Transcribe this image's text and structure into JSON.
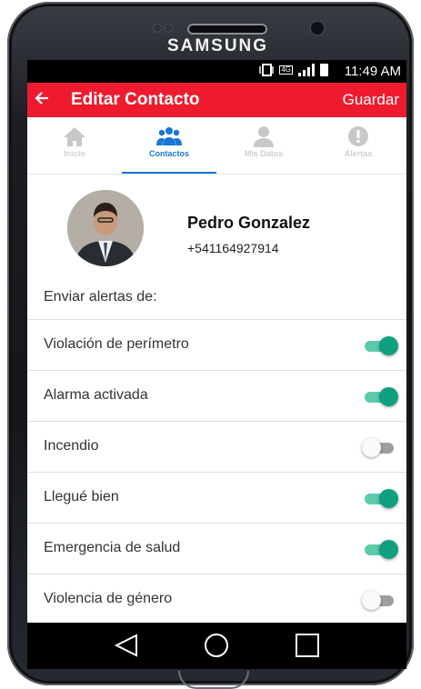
{
  "device": {
    "brand": "SAMSUNG"
  },
  "status_bar": {
    "time": "11:49 AM",
    "network": "4G"
  },
  "app_bar": {
    "title": "Editar Contacto",
    "back_icon": "arrow-left-icon",
    "save_label": "Guardar"
  },
  "tabs": [
    {
      "label": "Inicio",
      "icon": "home-icon",
      "active": false
    },
    {
      "label": "Contactos",
      "icon": "people-icon",
      "active": true
    },
    {
      "label": "Mis Datos",
      "icon": "person-icon",
      "active": false
    },
    {
      "label": "Alertas",
      "icon": "alert-icon",
      "active": false
    }
  ],
  "contact": {
    "name": "Pedro Gonzalez",
    "phone": "+541164927914"
  },
  "alerts": {
    "section_label": "Enviar alertas de:",
    "items": [
      {
        "label": "Violación de perímetro",
        "enabled": true
      },
      {
        "label": "Alarma activada",
        "enabled": true
      },
      {
        "label": "Incendio",
        "enabled": false
      },
      {
        "label": "Llegué bien",
        "enabled": true
      },
      {
        "label": "Emergencia de salud",
        "enabled": true
      },
      {
        "label": "Violencia de género",
        "enabled": false
      }
    ]
  },
  "colors": {
    "accent": "#ee1b2e",
    "tab_active": "#1976d2",
    "toggle_on": "#0fa080"
  },
  "nav": {
    "back": "nav-back-icon",
    "home": "nav-home-icon",
    "recents": "nav-recents-icon"
  }
}
